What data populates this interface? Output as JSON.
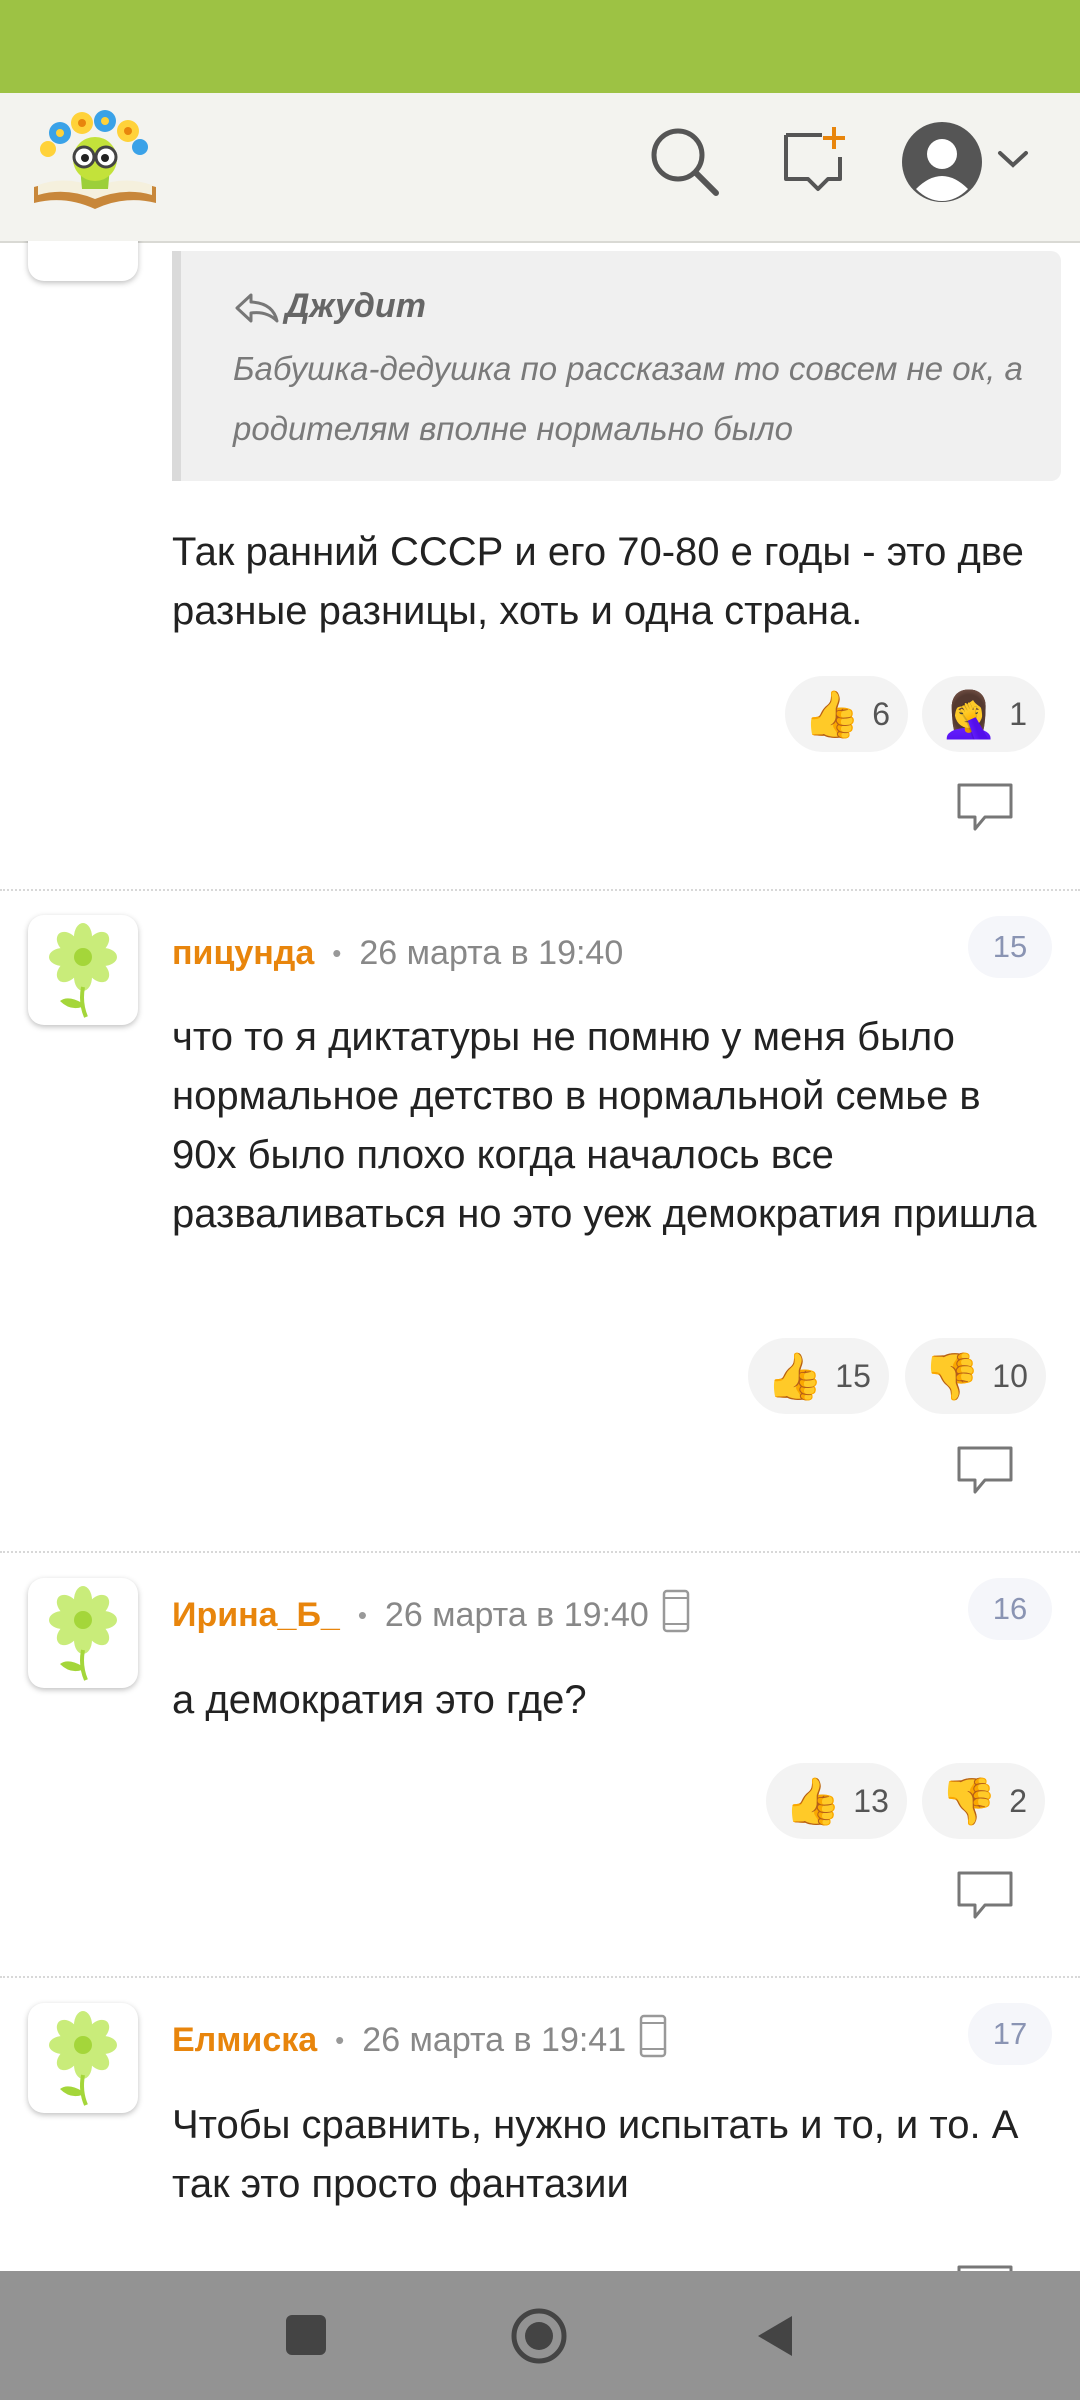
{
  "quote": {
    "author": "Джудит",
    "text": "Бабушка-дедушка по рассказам то совсем не ок, а родителям вполне нормально было"
  },
  "top_comment": {
    "text": "Так ранний СССР и его 70-80 е годы - это две разные разницы, хоть и одна страна.",
    "reactions": [
      {
        "emoji": "👍",
        "count": "6"
      },
      {
        "emoji": "🤦‍♀️",
        "count": "1"
      }
    ]
  },
  "comments": [
    {
      "user": "пицунда",
      "date": "26 марта в 19:40",
      "number": "15",
      "mobile": false,
      "text": "что то я диктатуры не помню у меня было нормальное детство в нормальной семье в 90х было плохо когда началось все разваливаться но это уеж демократия пришла",
      "reactions": [
        {
          "emoji": "👍",
          "count": "15"
        },
        {
          "emoji": "👎",
          "count": "10"
        }
      ]
    },
    {
      "user": "Ирина_Б_",
      "date": "26 марта в 19:40",
      "number": "16",
      "mobile": true,
      "text": "а демократия это где?",
      "reactions": [
        {
          "emoji": "👍",
          "count": "13"
        },
        {
          "emoji": "👎",
          "count": "2"
        }
      ]
    },
    {
      "user": "Елмиска",
      "date": "26 марта в 19:41",
      "number": "17",
      "mobile": true,
      "text": "Чтобы сравнить, нужно испытать и то, и то. А так это просто фантазии",
      "reactions": []
    }
  ],
  "colors": {
    "status_bar": "#9dc244",
    "username": "#e8850c",
    "badge_text": "#8a94b3"
  },
  "icons": [
    "logo-icon",
    "search-icon",
    "new-post-icon",
    "profile-icon",
    "chevron-down-icon",
    "reply-icon",
    "phone-icon",
    "flower-avatar-icon"
  ]
}
